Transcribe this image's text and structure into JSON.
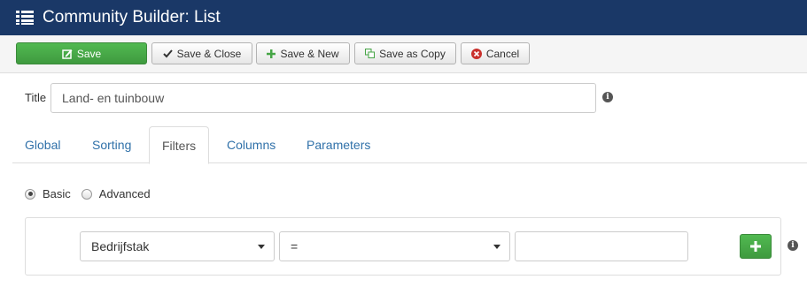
{
  "header": {
    "title": "Community Builder: List",
    "icon": "list-icon"
  },
  "toolbar": {
    "save": "Save",
    "save_close": "Save & Close",
    "save_new": "Save & New",
    "save_copy": "Save as Copy",
    "cancel": "Cancel"
  },
  "form": {
    "title_label": "Title",
    "title_value": "Land- en tuinbouw"
  },
  "tabs": [
    "Global",
    "Sorting",
    "Filters",
    "Columns",
    "Parameters"
  ],
  "active_tab": "Filters",
  "filter_mode": {
    "basic": "Basic",
    "advanced": "Advanced",
    "selected": "Basic"
  },
  "filter": {
    "field": "Bedrijfstak",
    "operator": "=",
    "value": ""
  },
  "colors": {
    "header": "#1a3867",
    "success": "#46a546",
    "link": "#3071a9"
  }
}
